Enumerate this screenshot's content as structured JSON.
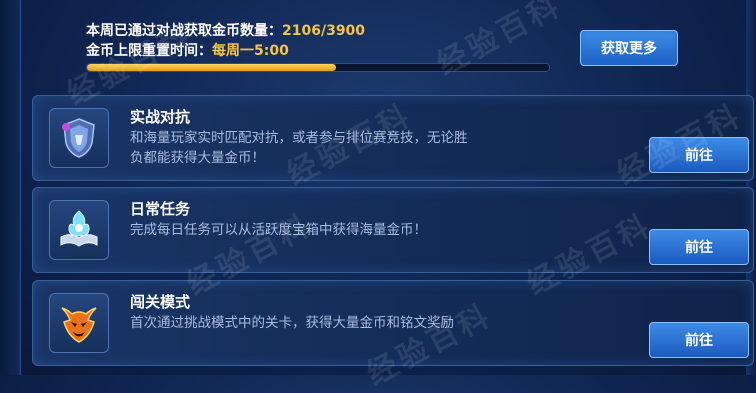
{
  "header": {
    "weekly_label": "本周已通过对战获取金币数量：",
    "weekly_value": "2106/3900",
    "reset_label": "金币上限重置时间：",
    "reset_value": "每周一5:00",
    "progress_fraction": 0.54,
    "more_button": "获取更多"
  },
  "cards": [
    {
      "title": "实战对抗",
      "desc": "和海量玩家实时匹配对抗，或者参与排位赛竞技，无论胜负都能获得大量金币！",
      "button": "前往",
      "icon": "shield-helmet-icon"
    },
    {
      "title": "日常任务",
      "desc": "完成每日任务可以从活跃度宝箱中获得海量金币！",
      "button": "前往",
      "icon": "magic-book-icon"
    },
    {
      "title": "闯关模式",
      "desc": "首次通过挑战模式中的关卡，获得大量金币和铭文奖励",
      "button": "前往",
      "icon": "demon-mask-icon"
    }
  ],
  "watermark": "经验百科",
  "colors": {
    "accent_gold": "#f5c542",
    "button_blue": "#2a70d6",
    "panel": "#132b56"
  }
}
